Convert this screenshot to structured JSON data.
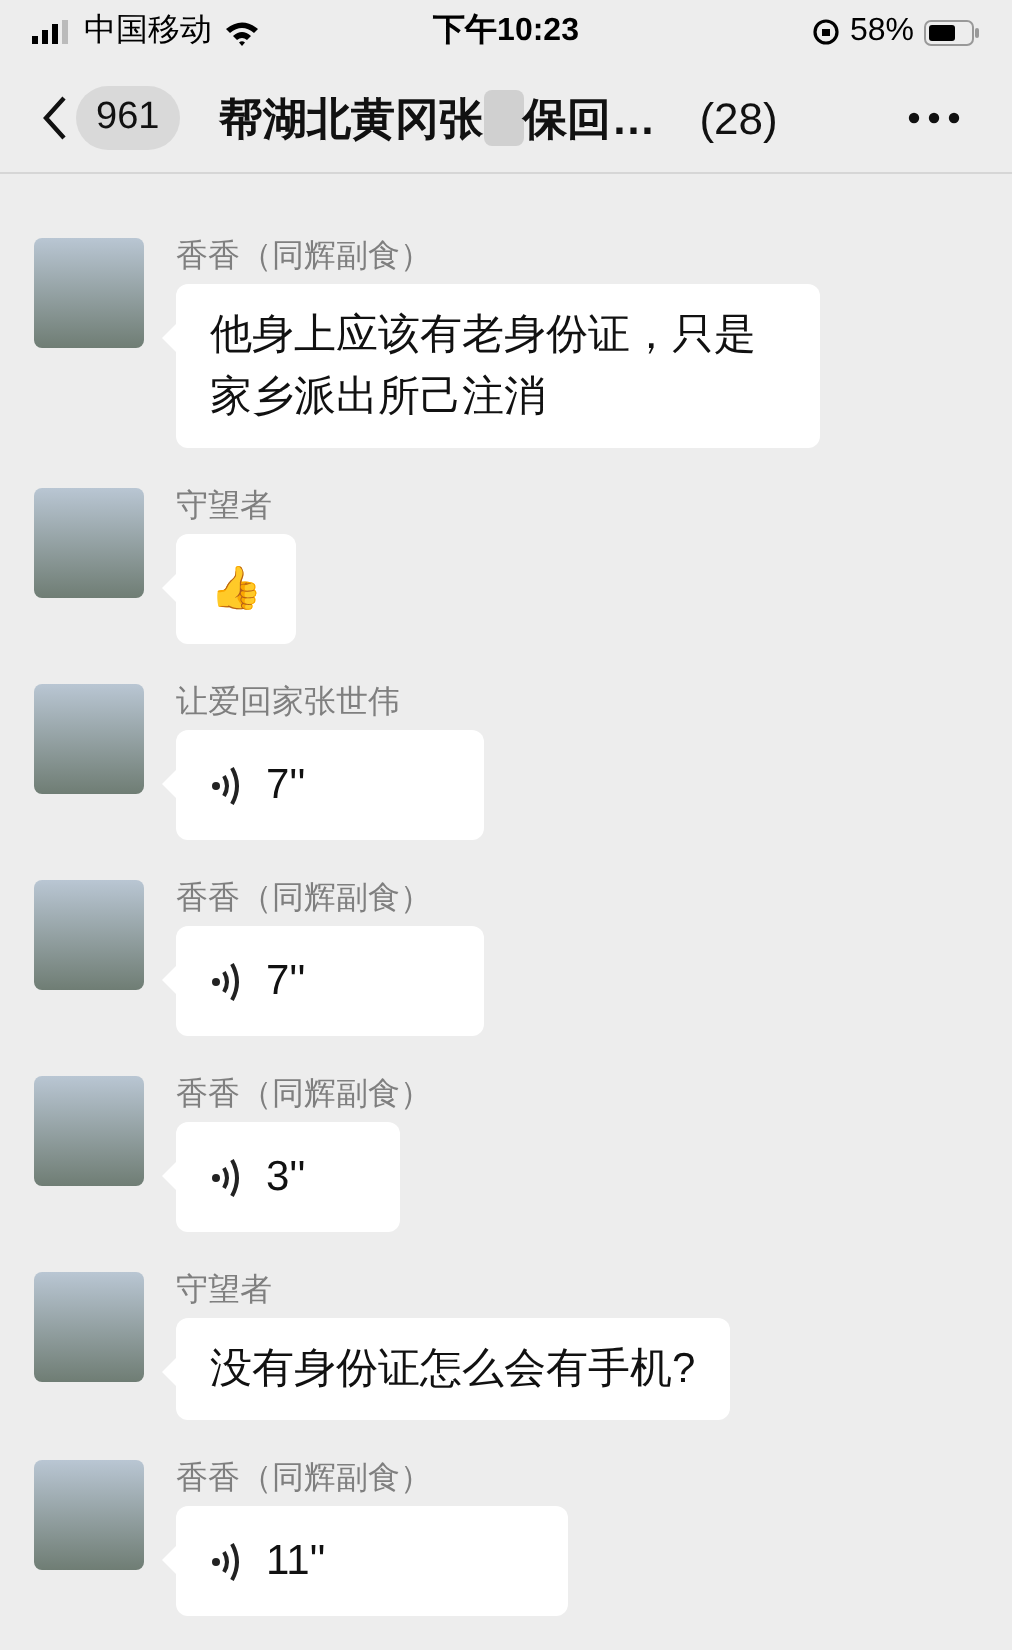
{
  "status_bar": {
    "carrier": "中国移动",
    "time": "下午10:23",
    "battery": "58%"
  },
  "header": {
    "unread_count": "961",
    "title_start": "帮湖北黄冈张",
    "title_end": "保回…",
    "member_count": "(28)"
  },
  "messages": [
    {
      "sender": "香香（同辉副食）",
      "kind": "text",
      "text": "他身上应该有老身份证，只是家乡派出所己注消"
    },
    {
      "sender": "守望者",
      "kind": "emoji",
      "text": "👍"
    },
    {
      "sender": "让爱回家张世伟",
      "kind": "voice",
      "text": "7''"
    },
    {
      "sender": "香香（同辉副食）",
      "kind": "voice",
      "text": "7''"
    },
    {
      "sender": "香香（同辉副食）",
      "kind": "voice",
      "text": "3''"
    },
    {
      "sender": "守望者",
      "kind": "text",
      "text": "没有身份证怎么会有手机?"
    },
    {
      "sender": "香香（同辉副食）",
      "kind": "voice",
      "text": "11''"
    }
  ]
}
